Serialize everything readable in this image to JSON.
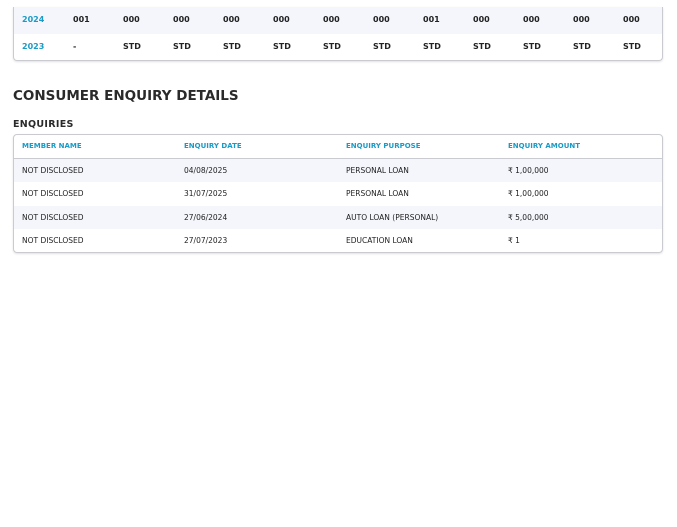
{
  "history_rows": [
    {
      "year": "2024",
      "values": [
        "001",
        "000",
        "000",
        "000",
        "000",
        "000",
        "000",
        "001",
        "000",
        "000",
        "000",
        "000"
      ]
    },
    {
      "year": "2023",
      "values": [
        "-",
        "STD",
        "STD",
        "STD",
        "STD",
        "STD",
        "STD",
        "STD",
        "STD",
        "STD",
        "STD",
        "STD"
      ]
    }
  ],
  "section_title": "CONSUMER ENQUIRY DETAILS",
  "subsection_title": "ENQUIRIES",
  "enquiries": {
    "headers": [
      "MEMBER NAME",
      "ENQUIRY DATE",
      "ENQUIRY PURPOSE",
      "ENQUIRY AMOUNT"
    ],
    "rows": [
      [
        "NOT DISCLOSED",
        "04/08/2025",
        "PERSONAL LOAN",
        "₹ 1,00,000"
      ],
      [
        "NOT DISCLOSED",
        "31/07/2025",
        "PERSONAL LOAN",
        "₹ 1,00,000"
      ],
      [
        "NOT DISCLOSED",
        "27/06/2024",
        "AUTO LOAN (PERSONAL)",
        "₹ 5,00,000"
      ],
      [
        "NOT DISCLOSED",
        "27/07/2023",
        "EDUCATION LOAN",
        "₹ 1"
      ]
    ]
  }
}
